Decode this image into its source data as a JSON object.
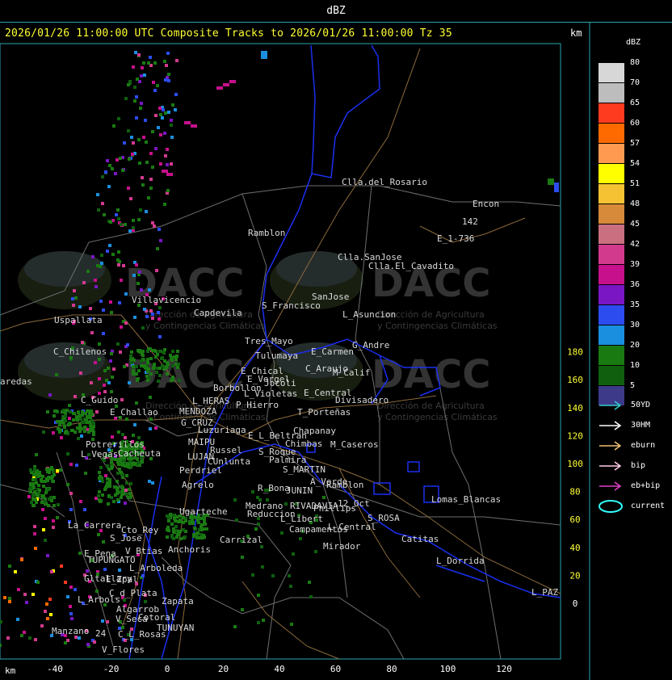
{
  "window": {
    "title": "dBZ"
  },
  "header": {
    "text": "2026/01/26 11:00:00 UTC Composite Tracks to 2026/01/26 11:00:00 Tz 35",
    "km_label": "km"
  },
  "axes": {
    "x_label": "km",
    "x_ticks": [
      "-40",
      "-20",
      "0",
      "20",
      "40",
      "60",
      "80",
      "100",
      "120"
    ],
    "y_ticks": [
      "180",
      "160",
      "140",
      "120",
      "100",
      "80",
      "60",
      "40",
      "20",
      "0"
    ]
  },
  "legend": {
    "title": "dBZ",
    "scale": [
      {
        "label": "80",
        "color": "#d7d7d7"
      },
      {
        "label": "70",
        "color": "#bdbdbd"
      },
      {
        "label": "65",
        "color": "#ff3b1f"
      },
      {
        "label": "60",
        "color": "#ff6a00"
      },
      {
        "label": "57",
        "color": "#ff9a50"
      },
      {
        "label": "54",
        "color": "#ffff00"
      },
      {
        "label": "51",
        "color": "#f5c233"
      },
      {
        "label": "48",
        "color": "#d68a3a"
      },
      {
        "label": "45",
        "color": "#c96f7f"
      },
      {
        "label": "42",
        "color": "#d23a8e"
      },
      {
        "label": "39",
        "color": "#c6108c"
      },
      {
        "label": "36",
        "color": "#7a16c4"
      },
      {
        "label": "35",
        "color": "#2c4cf0"
      },
      {
        "label": "30",
        "color": "#1a8fe0"
      },
      {
        "label": "20",
        "color": "#1a7a12"
      },
      {
        "label": "10",
        "color": "#0f5f0f"
      },
      {
        "label": "5",
        "color": "#3d3a8a"
      }
    ],
    "tracks": [
      {
        "label": "50YD",
        "color": "#33cccc"
      },
      {
        "label": "30HM",
        "color": "#ffffff"
      },
      {
        "label": "eburn",
        "color": "#f0c070"
      },
      {
        "label": "bip",
        "color": "#ffcce6"
      },
      {
        "label": "eb+bip",
        "color": "#e040c8"
      },
      {
        "label": "current",
        "color": "#33ffff"
      }
    ]
  },
  "watermark": {
    "brand": "DACC",
    "line1": "Dirección de Agricultura",
    "line2": "y Contingencias Climáticas"
  },
  "places": [
    {
      "name": "Clla.del_Rosario"
    },
    {
      "name": "Encon"
    },
    {
      "name": "142"
    },
    {
      "name": "E_1-736"
    },
    {
      "name": "Ramblon"
    },
    {
      "name": "Clla.SanJose"
    },
    {
      "name": "Clla.El_Cavadito"
    },
    {
      "name": "Villavicencio"
    },
    {
      "name": "S_Francisco"
    },
    {
      "name": "SanJose"
    },
    {
      "name": "Uspallata"
    },
    {
      "name": "Capdevila"
    },
    {
      "name": "L_Asuncion"
    },
    {
      "name": "C_Chilenos"
    },
    {
      "name": "Tres_Mayo"
    },
    {
      "name": "G_Andre"
    },
    {
      "name": "Tulumaya"
    },
    {
      "name": "E_Carmen"
    },
    {
      "name": "E_Chical"
    },
    {
      "name": "C_Araujo"
    },
    {
      "name": "M_Calif"
    },
    {
      "name": "E_Vergel"
    },
    {
      "name": "Jocoli"
    },
    {
      "name": "aredas"
    },
    {
      "name": "Borbollon"
    },
    {
      "name": "L_Violetas"
    },
    {
      "name": "E_Central"
    },
    {
      "name": "Divisadero"
    },
    {
      "name": "C_Guido"
    },
    {
      "name": "L_HERAS"
    },
    {
      "name": "P_Hierro"
    },
    {
      "name": "E_Challao"
    },
    {
      "name": "MENDOZA"
    },
    {
      "name": "T_Porteñas"
    },
    {
      "name": "G_CRUZ"
    },
    {
      "name": "Luzuriaga"
    },
    {
      "name": "Chapanay"
    },
    {
      "name": "E_L_Beltran"
    },
    {
      "name": "MAIPU"
    },
    {
      "name": "Chimbas"
    },
    {
      "name": "M_Caseros"
    },
    {
      "name": "Potrerillos"
    },
    {
      "name": "Russel"
    },
    {
      "name": "S_Roque"
    },
    {
      "name": "L_Vegas"
    },
    {
      "name": "Cacheuta"
    },
    {
      "name": "LUJAN"
    },
    {
      "name": "CUnlunta"
    },
    {
      "name": "Palmira"
    },
    {
      "name": "Perdriel"
    },
    {
      "name": "S_MARTIN"
    },
    {
      "name": "A_Verde"
    },
    {
      "name": "Ramblon"
    },
    {
      "name": "Agrelo"
    },
    {
      "name": "R_Bona"
    },
    {
      "name": "JUNIN"
    },
    {
      "name": "Lomas_Blancas"
    },
    {
      "name": "Medrano"
    },
    {
      "name": "RIVADAVIA"
    },
    {
      "name": "Phillips"
    },
    {
      "name": "12_Oct"
    },
    {
      "name": "Ugarteche"
    },
    {
      "name": "Reduccion"
    },
    {
      "name": "L_Libert"
    },
    {
      "name": "S_ROSA"
    },
    {
      "name": "La_Carrera"
    },
    {
      "name": "Cto_Rey"
    },
    {
      "name": "Campamentos"
    },
    {
      "name": "L_Central"
    },
    {
      "name": "Catitas"
    },
    {
      "name": "S_Jose"
    },
    {
      "name": "Carrizal"
    },
    {
      "name": "Anchoris"
    },
    {
      "name": "Mirador"
    },
    {
      "name": "E_Pena"
    },
    {
      "name": "V_Btias"
    },
    {
      "name": "TUPUNGATO"
    },
    {
      "name": "L_Dorrida"
    },
    {
      "name": "L_Arboleda"
    },
    {
      "name": "Gltallary"
    },
    {
      "name": "E_Zpal"
    },
    {
      "name": "C_d_Plata"
    },
    {
      "name": "L_PAZ"
    },
    {
      "name": "L_Arbols"
    },
    {
      "name": "Zapata"
    },
    {
      "name": "Algarrob"
    },
    {
      "name": "V_Seca"
    },
    {
      "name": "Cotoral"
    },
    {
      "name": "TUNUYAN"
    },
    {
      "name": "Manzano"
    },
    {
      "name": "24"
    },
    {
      "name": "C_L_Rosas"
    },
    {
      "name": "V_Flores"
    }
  ],
  "colors": {
    "frame": "#2aa6b3",
    "boundary": "#1a2ff0",
    "roads": "#8c6a3a",
    "depts": "#7a7a7a"
  }
}
